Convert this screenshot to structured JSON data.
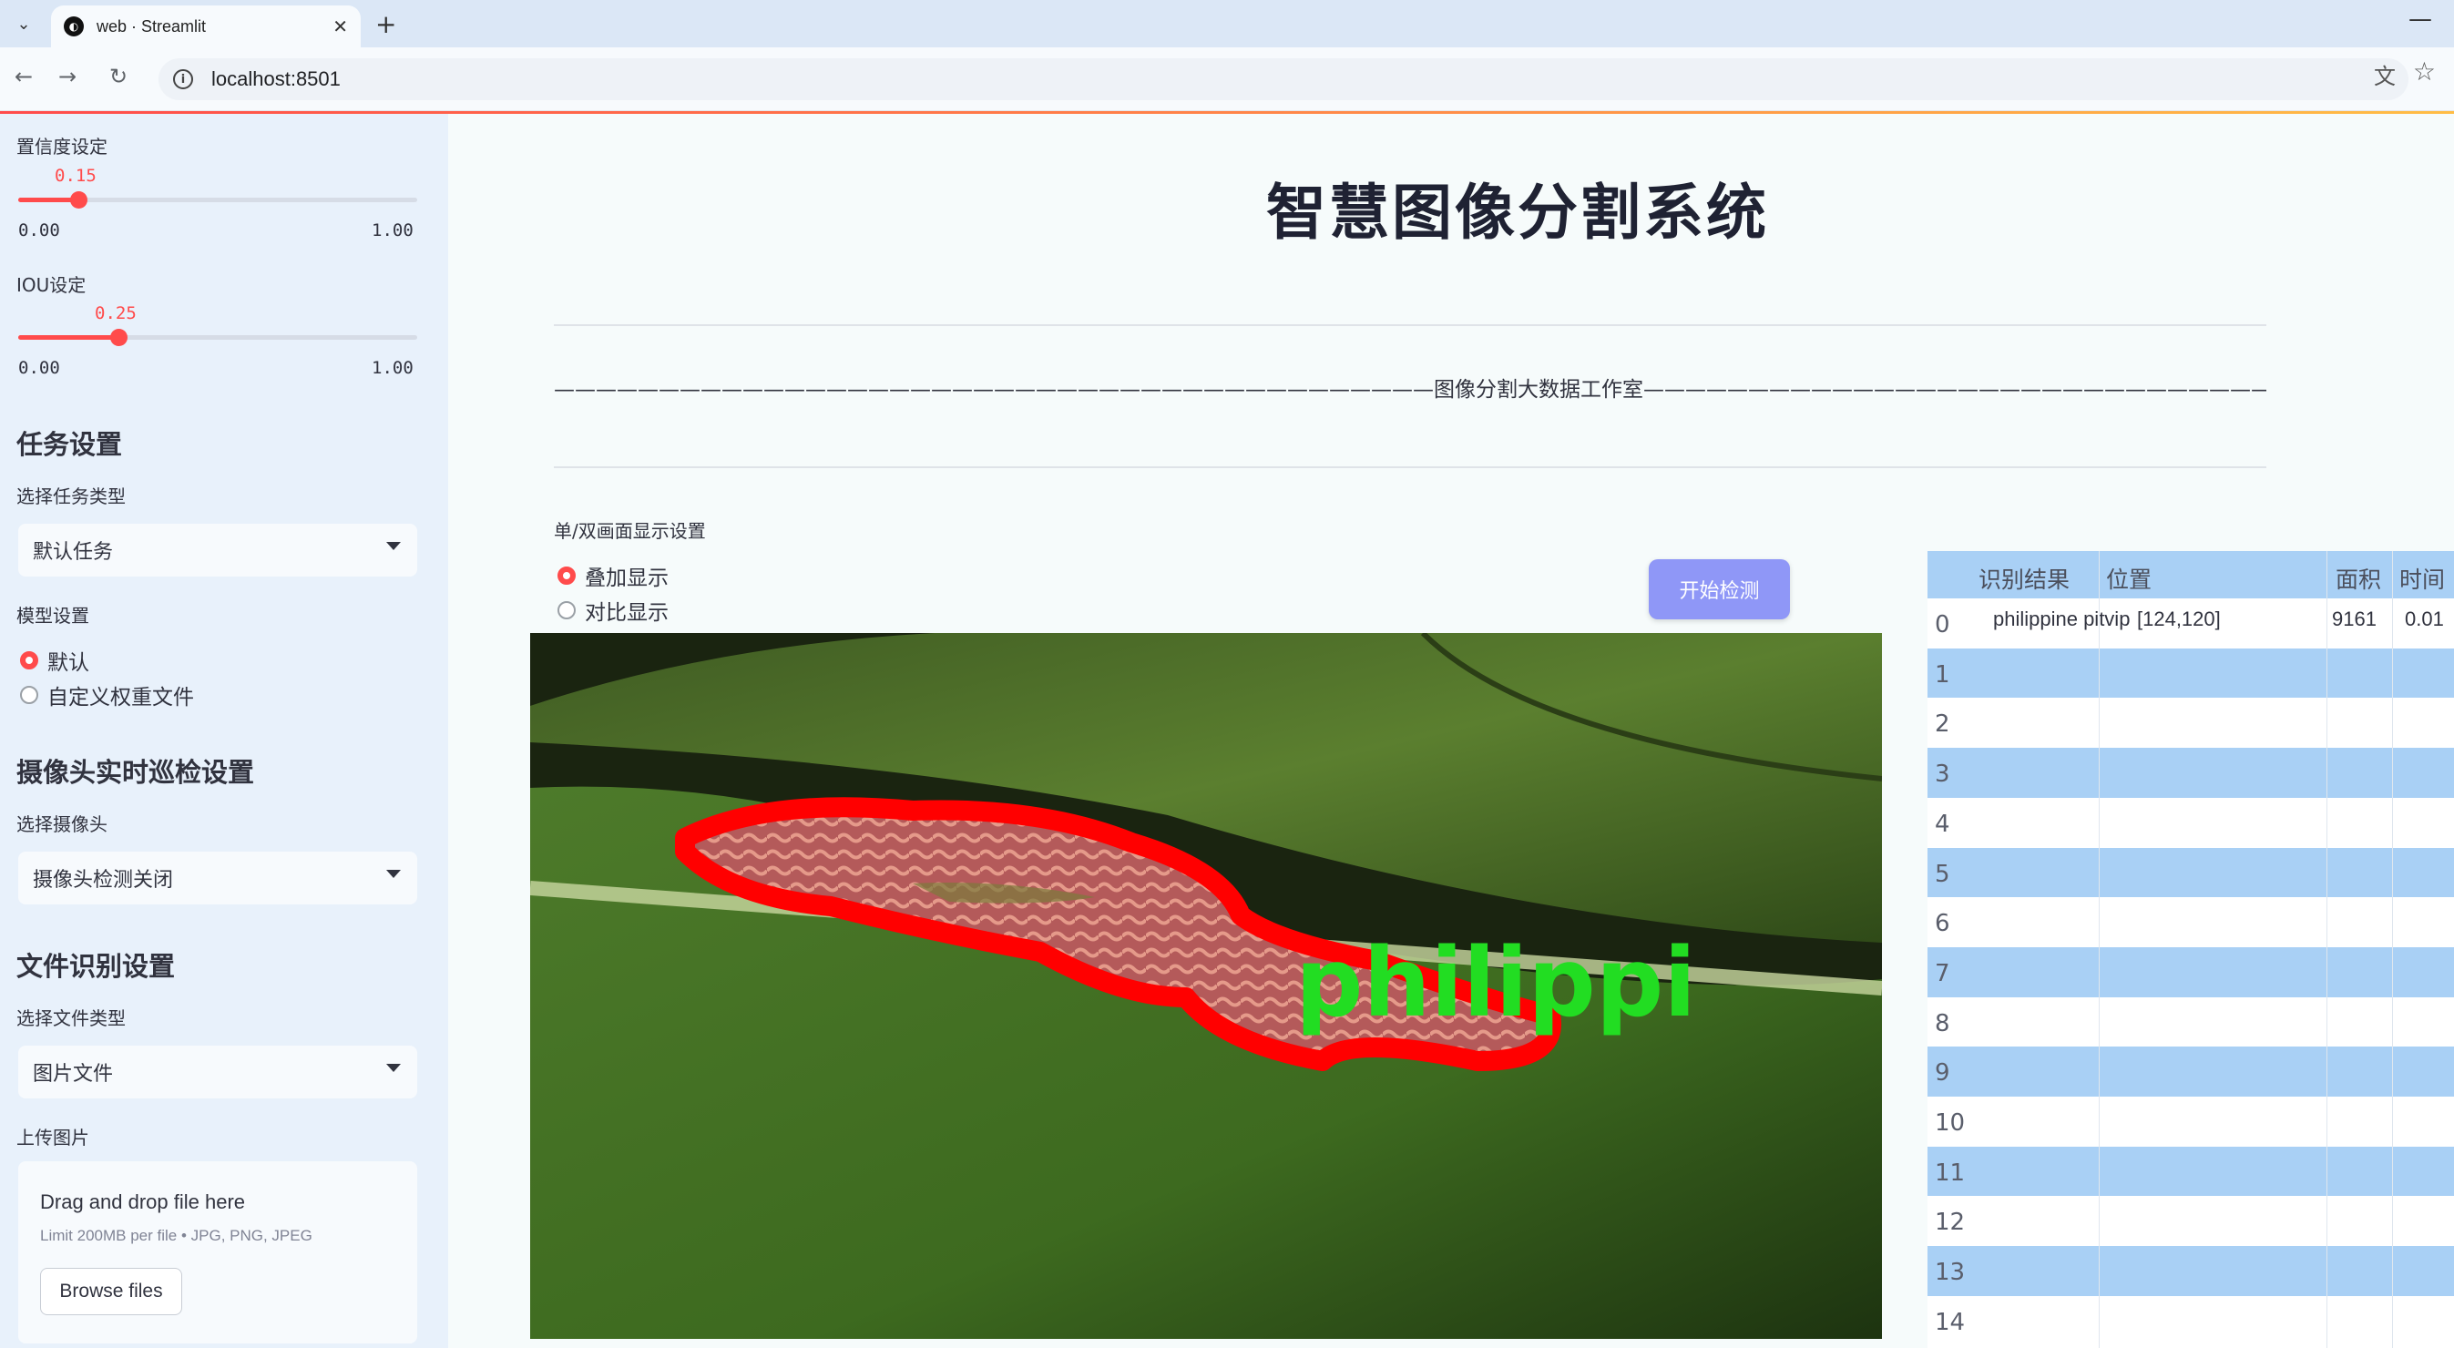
{
  "browser": {
    "tab_title": "web · Streamlit",
    "url": "localhost:8501"
  },
  "sidebar": {
    "confidence": {
      "label": "置信度设定",
      "value": "0.15",
      "min": "0.00",
      "max": "1.00",
      "fraction": 0.15
    },
    "iou": {
      "label": "IOU设定",
      "value": "0.25",
      "min": "0.00",
      "max": "1.00",
      "fraction": 0.25
    },
    "task_heading": "任务设置",
    "task_type_label": "选择任务类型",
    "task_type_value": "默认任务",
    "model_label": "模型设置",
    "model_options": [
      "默认",
      "自定义权重文件"
    ],
    "camera_heading": "摄像头实时巡检设置",
    "camera_label": "选择摄像头",
    "camera_value": "摄像头检测关闭",
    "file_heading": "文件识别设置",
    "file_type_label": "选择文件类型",
    "file_type_value": "图片文件",
    "upload_label": "上传图片",
    "upload_title": "Drag and drop file here",
    "upload_limit": "Limit 200MB per file • JPG, PNG, JPEG",
    "browse_label": "Browse files"
  },
  "main": {
    "title": "智慧图像分割系统",
    "studio_line": "——————————————————————————————————————————图像分割大数据工作室——————————————————————————————————————————",
    "display_label": "单/双画面显示设置",
    "display_options": [
      "叠加显示",
      "对比显示"
    ],
    "detect_button": "开始检测",
    "overlay_text": "philippi"
  },
  "table": {
    "columns": [
      "识别结果",
      "位置",
      "面积",
      "时间"
    ],
    "row_indices": [
      "0",
      "1",
      "2",
      "3",
      "4",
      "5",
      "6",
      "7",
      "8",
      "9",
      "10",
      "11",
      "12",
      "13",
      "14"
    ],
    "first_row": {
      "result": "philippine pitvip",
      "position": "[124,120]",
      "area": "9161",
      "time": "0.01"
    }
  },
  "colors": {
    "accent": "#ff4b4b",
    "button": "#8f97f7",
    "table_stripe": "#a9d0f5",
    "mask": "#ff0000",
    "label": "#22dd22"
  }
}
